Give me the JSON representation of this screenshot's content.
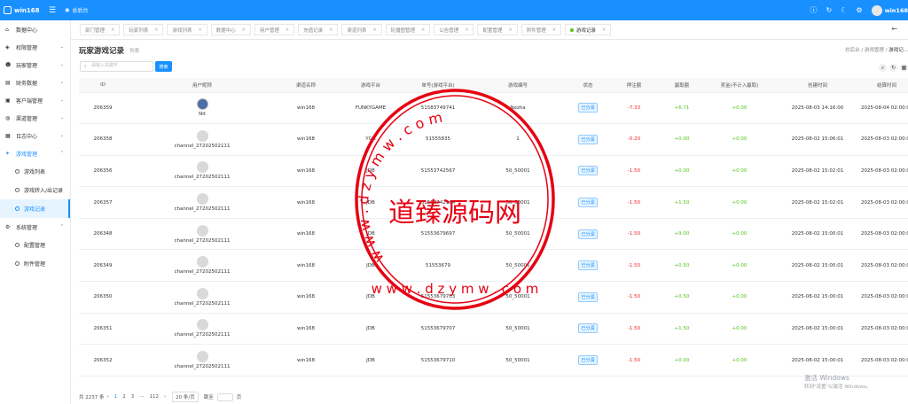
{
  "topbar": {
    "brand": "win168",
    "nav_label": "总后台",
    "user": "win168"
  },
  "sidebar": {
    "items": [
      {
        "label": "数据中心",
        "icon": "home-icon"
      },
      {
        "label": "权限管理",
        "icon": "shield-icon"
      },
      {
        "label": "玩家管理",
        "icon": "users-icon"
      },
      {
        "label": "财务数据",
        "icon": "finance-icon"
      },
      {
        "label": "客户端管理",
        "icon": "client-icon"
      },
      {
        "label": "渠道管理",
        "icon": "globe-icon"
      },
      {
        "label": "日志中心",
        "icon": "log-icon"
      },
      {
        "label": "游戏管理",
        "icon": "game-icon"
      },
      {
        "label": "系统管理",
        "icon": "gear-icon"
      }
    ],
    "game_sub": [
      "游戏列表",
      "游戏转入/出记录",
      "游戏记录"
    ],
    "system_sub": [
      "配置管理",
      "附件管理"
    ]
  },
  "tabs": [
    "部门管理",
    "玩家列表",
    "游戏列表",
    "数据中心",
    "用户管理",
    "充值记录",
    "渠道列表",
    "轮播图管理",
    "公告管理",
    "配置管理",
    "附件管理",
    "游戏记录"
  ],
  "page": {
    "title": "玩家游戏记录",
    "subtitle": "列表",
    "breadcrumb": [
      "总后台",
      "游戏管理",
      "游戏记..."
    ]
  },
  "search": {
    "placeholder": "请输入关键字",
    "button": "搜索"
  },
  "table": {
    "headers": [
      "ID",
      "用户昵称",
      "渠道名称",
      "游戏平台",
      "单号(游戏平台)",
      "游戏编号",
      "状态",
      "押注额",
      "赢取额",
      "奖金(不计入赢取)",
      "创建时间",
      "结算时间"
    ],
    "rows": [
      {
        "id": "206359",
        "user": "Nit",
        "channel": "win168",
        "platform": "FUNKYGAME",
        "order": "51583749741",
        "game": "Nezha",
        "status": "已分润",
        "bet": "-7.33",
        "win": "+6.71",
        "bonus": "+0.00",
        "created": "2025-08-03 14:16:00",
        "settled": "2025-08-04 02:00:00"
      },
      {
        "id": "206358",
        "user": "channel_27202502111",
        "channel": "win168",
        "platform": "YGR",
        "order": "51555835",
        "game": "1",
        "status": "已分润",
        "bet": "-0.20",
        "win": "+0.00",
        "bonus": "+0.00",
        "created": "2025-08-02 15:06:01",
        "settled": "2025-08-03 02:00:00"
      },
      {
        "id": "206356",
        "user": "channel_27202502111",
        "channel": "win168",
        "platform": "JDB",
        "order": "51553742567",
        "game": "50_50001",
        "status": "已分润",
        "bet": "-1.50",
        "win": "+0.00",
        "bonus": "+0.00",
        "created": "2025-08-02 15:02:01",
        "settled": "2025-08-03 02:00:00"
      },
      {
        "id": "206357",
        "user": "channel_27202502111",
        "channel": "win168",
        "platform": "JDB",
        "order": "51553742564",
        "game": "50_50001",
        "status": "已分润",
        "bet": "-1.50",
        "win": "+1.50",
        "bonus": "+0.00",
        "created": "2025-08-02 15:02:01",
        "settled": "2025-08-03 02:00:00"
      },
      {
        "id": "206348",
        "user": "channel_27202502111",
        "channel": "win168",
        "platform": "JDB",
        "order": "51553679697",
        "game": "50_50001",
        "status": "已分润",
        "bet": "-1.50",
        "win": "+9.00",
        "bonus": "+0.00",
        "created": "2025-08-02 15:00:01",
        "settled": "2025-08-03 02:00:00"
      },
      {
        "id": "206349",
        "user": "channel_27202502111",
        "channel": "win168",
        "platform": "JDB",
        "order": "51553679",
        "game": "50_50001",
        "status": "已分润",
        "bet": "-1.50",
        "win": "+0.50",
        "bonus": "+0.00",
        "created": "2025-08-02 15:00:01",
        "settled": "2025-08-03 02:00:00"
      },
      {
        "id": "206350",
        "user": "channel_27202502111",
        "channel": "win168",
        "platform": "JDB",
        "order": "51553679703",
        "game": "50_50001",
        "status": "已分润",
        "bet": "-1.50",
        "win": "+0.50",
        "bonus": "+0.00",
        "created": "2025-08-02 15:00:01",
        "settled": "2025-08-03 02:00:00"
      },
      {
        "id": "206351",
        "user": "channel_27202502111",
        "channel": "win168",
        "platform": "JDB",
        "order": "51553679707",
        "game": "50_50001",
        "status": "已分润",
        "bet": "-1.50",
        "win": "+1.50",
        "bonus": "+0.00",
        "created": "2025-08-02 15:00:01",
        "settled": "2025-08-03 02:00:00"
      },
      {
        "id": "206352",
        "user": "channel_27202502111",
        "channel": "win168",
        "platform": "JDB",
        "order": "51553679710",
        "game": "50_50001",
        "status": "已分润",
        "bet": "-1.50",
        "win": "+0.00",
        "bonus": "+0.00",
        "created": "2025-08-02 15:00:01",
        "settled": "2025-08-03 02:00:00"
      }
    ]
  },
  "pager": {
    "total": "共 2237 条",
    "pages": [
      "1",
      "2",
      "3",
      "···",
      "112"
    ],
    "size": "20 条/页",
    "goto": "跳至",
    "unit": "页"
  },
  "watermark": {
    "title": "道臻源码网",
    "ring": "w w w . d z y m w . c o m"
  },
  "windows": {
    "line1": "激活 Windows",
    "line2": "转到\"设置\"以激活 Windows。"
  }
}
